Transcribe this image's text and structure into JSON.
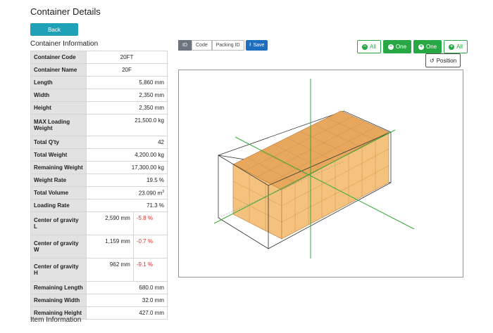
{
  "page": {
    "title": "Container Details",
    "back_label": "Back",
    "section_container": "Container Information",
    "section_item": "Item Information"
  },
  "container_info": {
    "code_label": "Container Code",
    "code": "20FT",
    "name_label": "Container Name",
    "name": "20F",
    "length_label": "Length",
    "length": "5,860 mm",
    "width_label": "Width",
    "width": "2,350 mm",
    "height_label": "Height",
    "height": "2,350 mm",
    "max_weight_label": "MAX Loading Weight",
    "max_weight": "21,500.0 kg",
    "qty_label": "Total Q'ty",
    "qty": "42",
    "total_weight_label": "Total Weight",
    "total_weight": "4,200.00 kg",
    "remaining_weight_label": "Remaining Weight",
    "remaining_weight": "17,300.00 kg",
    "weight_rate_label": "Weight Rate",
    "weight_rate": "19.5 %",
    "total_volume_label": "Total Volume",
    "total_volume": "23.090 m",
    "total_volume_sup": "3",
    "loading_rate_label": "Loading Rate",
    "loading_rate": "71.3 %",
    "cog_l_label": "Center of gravity L",
    "cog_l_mm": "2,590 mm",
    "cog_l_pct": "-5.8 %",
    "cog_w_label": "Center of gravity W",
    "cog_w_mm": "1,159 mm",
    "cog_w_pct": "-0.7 %",
    "cog_h_label": "Center of gravity H",
    "cog_h_mm": "962 mm",
    "cog_h_pct": "-9.1 %",
    "rem_length_label": "Remaining Length",
    "rem_length": "680.0 mm",
    "rem_width_label": "Remaining Width",
    "rem_width": "32.0 mm",
    "rem_height_label": "Remaining Height",
    "rem_height": "427.0 mm"
  },
  "toolbar": {
    "id_label": "ID",
    "code_label": "Code",
    "packing_label": "Packing ID",
    "save_label": "Save"
  },
  "view_controls": {
    "minus_all": "All",
    "minus_one": "One",
    "plus_one": "One",
    "plus_all": "All",
    "position": "Position"
  },
  "colors": {
    "accent_teal": "#1fa2b8",
    "save_blue": "#1f6fbf",
    "green": "#28a745",
    "negative_red": "#d9302c",
    "box_top": "#e7a85e",
    "box_side": "#f4c27c"
  }
}
